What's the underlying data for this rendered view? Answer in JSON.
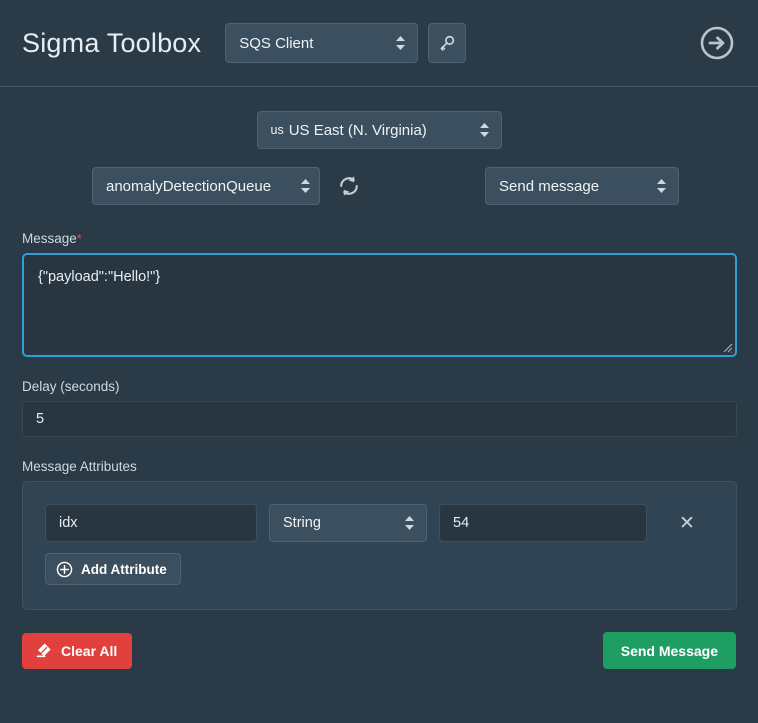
{
  "header": {
    "title": "Sigma Toolbox",
    "client_select": {
      "value": "SQS Client",
      "icon": "chevron-updown-icon"
    },
    "credentials_button": {
      "icon": "key-icon"
    },
    "forward_button": {
      "icon": "arrow-right-circle-icon"
    }
  },
  "toolbar": {
    "region_select": {
      "code": "us",
      "value": "US East (N. Virginia)"
    },
    "queue_select": {
      "value": "anomalyDetectionQueue"
    },
    "refresh_button": {
      "icon": "refresh-icon"
    },
    "action_select": {
      "value": "Send message"
    }
  },
  "form": {
    "message": {
      "label": "Message",
      "required_marker": "*",
      "value": "{\"payload\":\"Hello!\"}"
    },
    "delay": {
      "label": "Delay (seconds)",
      "value": "5"
    },
    "attributes": {
      "label": "Message Attributes",
      "rows": [
        {
          "name": "idx",
          "type": "String",
          "value": "54",
          "remove_label": "✕"
        }
      ],
      "add_label": "Add Attribute",
      "add_icon": "plus-circle-icon"
    }
  },
  "footer": {
    "clear_label": "Clear All",
    "clear_icon": "eraser-icon",
    "send_label": "Send Message"
  },
  "colors": {
    "background": "#2b3a47",
    "panel": "#314453",
    "control": "#3c4f5e",
    "input": "#273641",
    "focus_border": "#2f9fd6",
    "danger": "#e0413c",
    "success": "#1f9e63",
    "required": "#e8543f",
    "text": "#e9eef2"
  }
}
